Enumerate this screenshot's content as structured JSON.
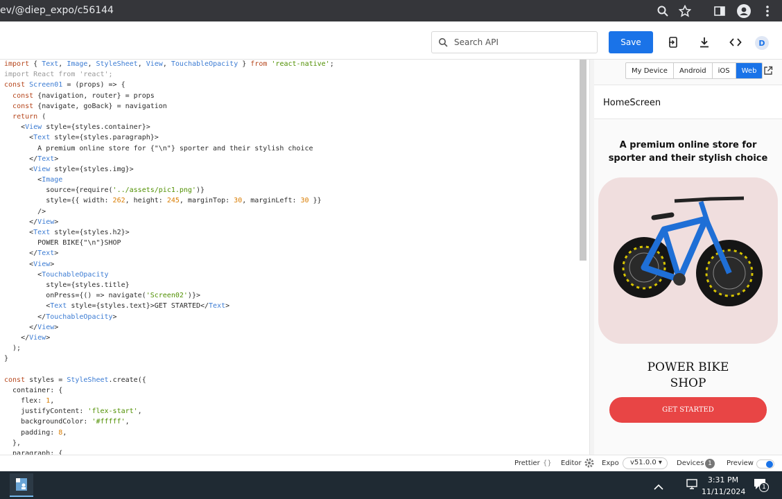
{
  "browser": {
    "url": "ev/@diep_expo/c56144"
  },
  "toolbar": {
    "search_placeholder": "Search API",
    "save_label": "Save",
    "avatar_letter": "D"
  },
  "editor": {
    "lines": [
      "import { Text, Image, StyleSheet, View, TouchableOpacity } from 'react-native';",
      "import React from 'react';",
      "const Screen01 = (props) => {",
      "  const {navigation, router} = props",
      "  const {navigate, goBack} = navigation",
      "  return (",
      "    <View style={styles.container}>",
      "      <Text style={styles.paragraph}>",
      "        A premium online store for {\"\\n\"} sporter and their stylish choice",
      "      </Text>",
      "      <View style={styles.img}>",
      "        <Image",
      "          source={require('../assets/pic1.png')}",
      "          style={{ width: 262, height: 245, marginTop: 30, marginLeft: 30 }}",
      "        />",
      "      </View>",
      "      <Text style={styles.h2}>",
      "        POWER BIKE{\"\\n\"}SHOP",
      "      </Text>",
      "      <View>",
      "        <TouchableOpacity",
      "          style={styles.title}",
      "          onPress={() => navigate('Screen02')}>",
      "          <Text style={styles.text}>GET STARTED</Text>",
      "        </TouchableOpacity>",
      "      </View>",
      "    </View>",
      "  );",
      "}",
      "",
      "const styles = StyleSheet.create({",
      "  container: {",
      "    flex: 1,",
      "    justifyContent: 'flex-start',",
      "    backgroundColor: '#fffff',",
      "    padding: 8,",
      "  },",
      "  paragraph: {"
    ]
  },
  "preview": {
    "tabs": [
      "My Device",
      "Android",
      "iOS",
      "Web"
    ],
    "active_tab": "Web",
    "screen_title": "HomeScreen",
    "paragraph_line1": "A premium online store for",
    "paragraph_line2": "sporter and their stylish choice",
    "h2_line1": "POWER BIKE",
    "h2_line2": "SHOP",
    "button_label": "GET STARTED"
  },
  "statusbar": {
    "prettier": "Prettier",
    "prettier_icon": "{}",
    "editor": "Editor",
    "expo": "Expo",
    "expo_version": "v51.0.0",
    "devices": "Devices",
    "devices_count": "1",
    "preview": "Preview"
  },
  "taskbar": {
    "time": "3:31 PM",
    "date": "11/11/2024",
    "notification_count": "1"
  },
  "colors": {
    "accent": "#1a73e8",
    "button_red": "#e84545",
    "image_bg": "#f0dede"
  }
}
